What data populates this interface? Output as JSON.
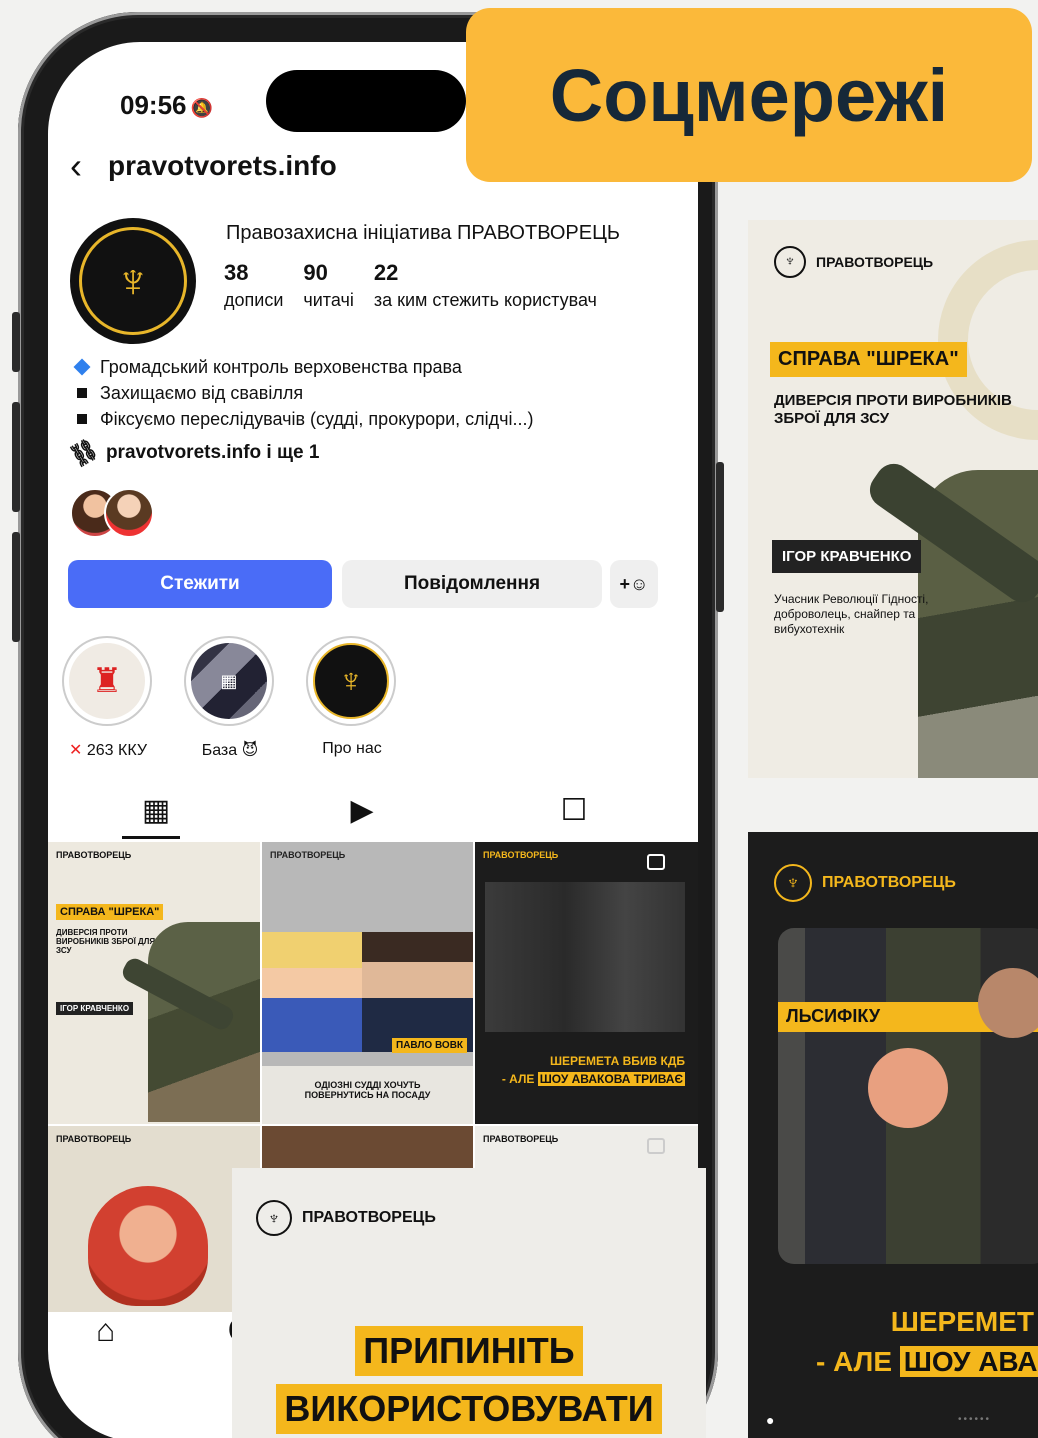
{
  "badge": {
    "title": "Соцмережі"
  },
  "phone": {
    "status_time": "09:56",
    "handle": "pravotvorets.info",
    "profile_name": "Правозахисна ініціатива ПРАВОТВОРЕЦЬ",
    "stats": [
      {
        "num": "38",
        "label": "дописи"
      },
      {
        "num": "90",
        "label": "читачі"
      },
      {
        "num": "22",
        "label": "за ким стежить користувач"
      }
    ],
    "bio": [
      "Громадський контроль верховенства права",
      "Захищаємо від свавілля",
      "Фіксуємо переслідувачів (судді, прокурори, слідчі...)"
    ],
    "link": "pravotvorets.info і ще 1",
    "buttons": {
      "follow": "Стежити",
      "message": "Повідомлення",
      "add_person": "+&"
    },
    "highlights": [
      {
        "label": "263 ККУ",
        "prefix": "✕"
      },
      {
        "label": "База",
        "suffix": "😈"
      },
      {
        "label": "Про нас"
      }
    ],
    "grid": {
      "post1_brand": "ПРАВОТВОРЕЦЬ",
      "post1_title": "СПРАВА \"ШРЕКА\"",
      "post1_sub": "ДИВЕРСІЯ ПРОТИ ВИРОБНИКІВ ЗБРОЇ ДЛЯ ЗСУ",
      "post1_name": "ІГОР КРАВЧЕНКО",
      "post2_brand": "ПРАВОТВОРЕЦЬ",
      "post2_tag": "ПАВЛО ВОВК",
      "post2_caption": "ОДІОЗНІ СУДДІ ХОЧУТЬ ПОВЕРНУТИСЬ НА ПОСАДУ",
      "post3_brand": "ПРАВОТВОРЕЦЬ",
      "post3_line1": "ШЕРЕМЕТА ВБИВ КДБ",
      "post3_line2_a": "- АЛЕ",
      "post3_line2_b": "ШОУ АВАКОВА ТРИВАЄ",
      "post4_brand": "ПРАВОТВОРЕЦЬ",
      "post6_brand": "ПРАВОТВОРЕЦЬ"
    }
  },
  "card_shrek": {
    "brand": "ПРАВОТВОРЕЦЬ",
    "title": "СПРАВА \"ШРЕКА\"",
    "subtitle": "ДИВЕРСІЯ ПРОТИ ВИРОБНИКІВ ЗБРОЇ ДЛЯ ЗСУ",
    "name": "ІГОР КРАВЧЕНКО",
    "description": "Учасник Революції Гідності, доброволець, снайпер та вибухотехнік"
  },
  "card_sheremeta": {
    "brand": "ПРАВОТВОРЕЦЬ",
    "banner": "ЛЬСИФІКУ",
    "line1": "ШЕРЕМЕТ",
    "line2_a": "- АЛЕ",
    "line2_b": "ШОУ АВАКО"
  },
  "card_stop": {
    "brand": "ПРАВОТВОРЕЦЬ",
    "line1": "ПРИПИНІТЬ",
    "line2": "ВИКОРИСТОВУВАТИ"
  }
}
